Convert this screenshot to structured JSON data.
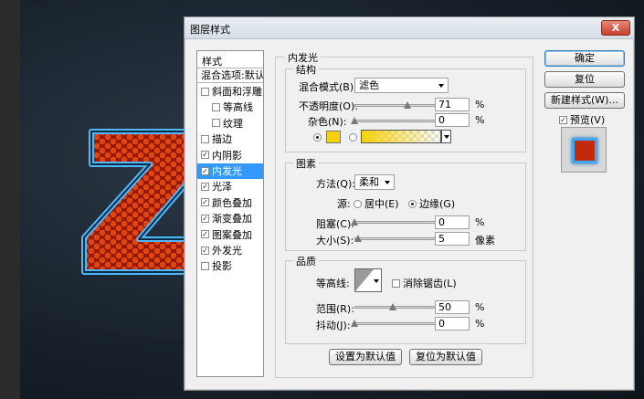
{
  "dialog": {
    "title": "图层样式",
    "close_glyph": "X"
  },
  "styles_panel": {
    "header": "样式",
    "blend_options": "混合选项:默认",
    "items": [
      {
        "label": "斜面和浮雕",
        "checked": false,
        "indent": false
      },
      {
        "label": "等高线",
        "checked": false,
        "indent": true
      },
      {
        "label": "纹理",
        "checked": false,
        "indent": true
      },
      {
        "label": "描边",
        "checked": false,
        "indent": false
      },
      {
        "label": "内阴影",
        "checked": true,
        "indent": false
      },
      {
        "label": "内发光",
        "checked": true,
        "indent": false,
        "selected": true
      },
      {
        "label": "光泽",
        "checked": true,
        "indent": false
      },
      {
        "label": "颜色叠加",
        "checked": true,
        "indent": false
      },
      {
        "label": "渐变叠加",
        "checked": true,
        "indent": false
      },
      {
        "label": "图案叠加",
        "checked": true,
        "indent": false
      },
      {
        "label": "外发光",
        "checked": true,
        "indent": false
      },
      {
        "label": "投影",
        "checked": false,
        "indent": false
      }
    ]
  },
  "inner_glow": {
    "title": "内发光",
    "structure": {
      "title": "结构",
      "blend_mode_label": "混合模式(B):",
      "blend_mode_value": "滤色",
      "opacity_label": "不透明度(O):",
      "opacity_value": "71",
      "opacity_unit": "%",
      "noise_label": "杂色(N):",
      "noise_value": "0",
      "noise_unit": "%",
      "glow_color": "#f5d10a",
      "gradient_from": "#f5d10a"
    },
    "elements": {
      "title": "图素",
      "method_label": "方法(Q):",
      "method_value": "柔和",
      "source_label": "源:",
      "source_center": "居中(E)",
      "source_edge": "边缘(G)",
      "choke_label": "阻塞(C):",
      "choke_value": "0",
      "choke_unit": "%",
      "size_label": "大小(S):",
      "size_value": "5",
      "size_unit": "像素"
    },
    "quality": {
      "title": "品质",
      "contour_label": "等高线:",
      "antialias_label": "消除锯齿(L)",
      "range_label": "范围(R):",
      "range_value": "50",
      "range_unit": "%",
      "jitter_label": "抖动(J):",
      "jitter_value": "0",
      "jitter_unit": "%"
    },
    "make_default": "设置为默认值",
    "reset_default": "复位为默认值"
  },
  "actions": {
    "ok": "确定",
    "reset": "复位",
    "new_style": "新建样式(W)...",
    "preview_label": "预览(V)",
    "preview_checked": true
  }
}
